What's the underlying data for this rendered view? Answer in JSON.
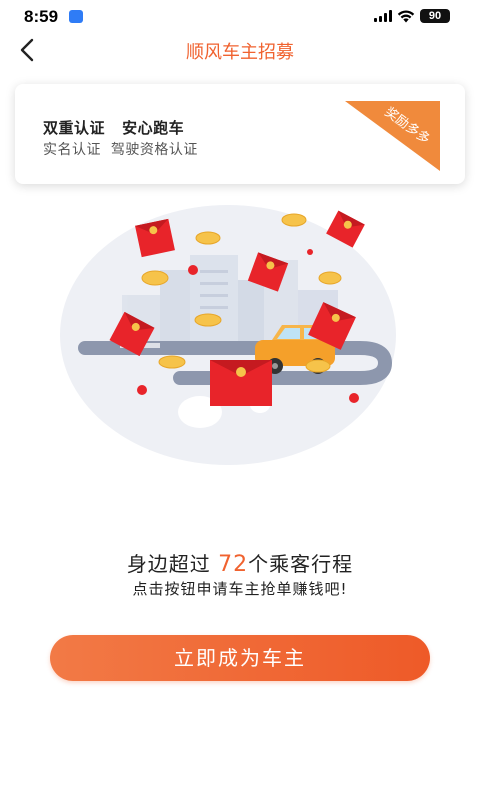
{
  "status_bar": {
    "time": "8:59",
    "battery": "90",
    "icons": [
      "app-notification-icon",
      "signal-icon",
      "wifi-icon",
      "battery-icon"
    ]
  },
  "nav": {
    "title": "顺风车主招募",
    "back_icon": "chevron-left-icon"
  },
  "card": {
    "title": "双重认证   安心跑车",
    "subtitle": "实名认证  驾驶资格认证",
    "ribbon": "奖励多多"
  },
  "illustration": {
    "icons": [
      "city-skyline",
      "car-icon",
      "red-envelope-icon",
      "gold-ingot-icon"
    ]
  },
  "promo": {
    "prefix": "身边超过 ",
    "count": "72",
    "suffix": "个乘客行程",
    "line2": "点击按钮申请车主抢单赚钱吧!"
  },
  "cta": {
    "label": "立即成为车主"
  },
  "colors": {
    "accent": "#f0622f",
    "button_start": "#f27a46",
    "button_end": "#ee5a28",
    "ribbon": "#f08a3c"
  }
}
